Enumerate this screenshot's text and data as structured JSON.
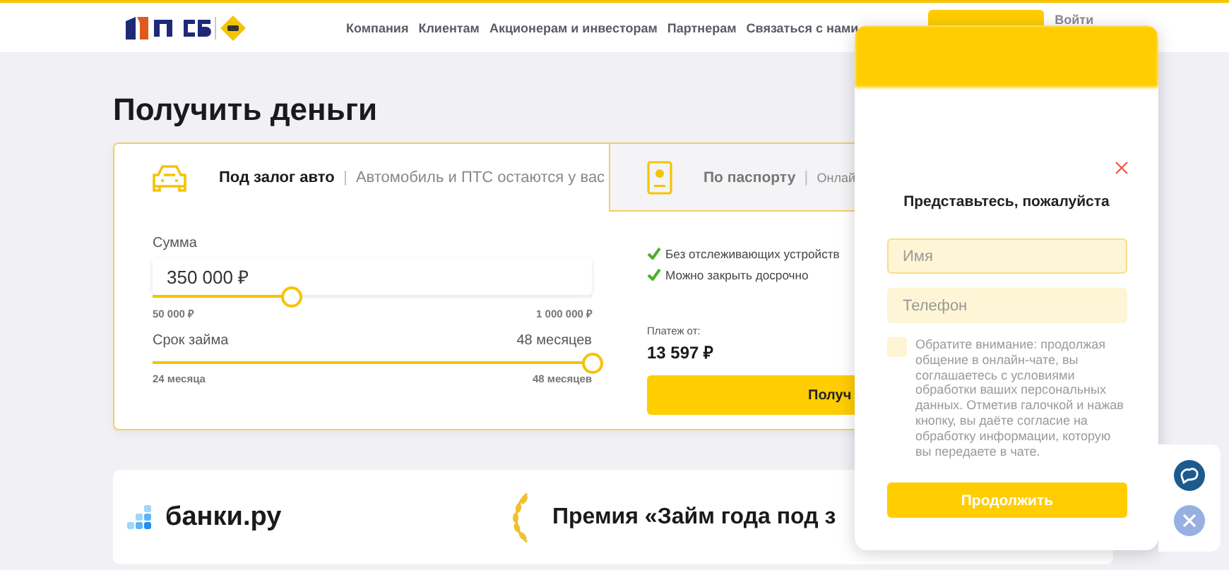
{
  "header": {
    "nav": [
      "Компания",
      "Клиентам",
      "Акционерам и инвесторам",
      "Партнерам",
      "Связаться с нами"
    ],
    "login": "Войти"
  },
  "page_title": "Получить деньги",
  "loan_tabs": [
    {
      "kind": "car",
      "title": "Под залог авто",
      "subtitle": "Автомобиль и ПТС остаются у вас",
      "separator": "|",
      "selected": true
    },
    {
      "kind": "passport",
      "title": "По паспорту",
      "subtitle": "Онлай",
      "separator": "|",
      "selected": false
    }
  ],
  "amount": {
    "label": "Сумма",
    "value": "350 000 ₽",
    "level": 0.315,
    "min": "50 000 ₽",
    "max": "1 000 000 ₽"
  },
  "term": {
    "label": "Срок займа",
    "value": "48 месяцев",
    "level": 1,
    "min": "24 месяца",
    "max": "48 месяцев"
  },
  "features": [
    "Без отслеживающих устройств",
    "Можно закрыть досрочно"
  ],
  "payment": {
    "label": "Платеж от:",
    "value": "13 597 ₽"
  },
  "submit_button": "Получ",
  "awards": [
    {
      "kind": "logo",
      "text": "банки.ру"
    },
    {
      "kind": "laurel",
      "text": "Премия «Займ года под з"
    }
  ],
  "chat": {
    "title": "Представьтесь, пожалуйста",
    "fields": [
      {
        "placeholder": "Имя",
        "focused": true
      },
      {
        "placeholder": "Телефон",
        "focused": false
      }
    ],
    "consent": {
      "checked": false,
      "text": "Обратите внимание: продолжая общение в онлайн-чате, вы соглашаетесь с условиями обработки ваших персональных данных. Отметив галочкой и нажав кнопку, вы даёте согласие на обработку информации, которую вы передаете в чате."
    },
    "button": "Продолжить"
  }
}
